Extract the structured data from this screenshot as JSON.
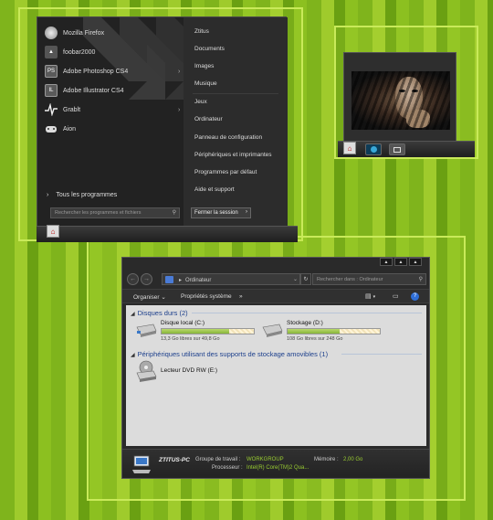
{
  "start_menu": {
    "programs": [
      {
        "label": "Mozilla Firefox",
        "icon": "firefox-icon",
        "submenu": false
      },
      {
        "label": "foobar2000",
        "icon": "foobar-icon",
        "submenu": false
      },
      {
        "label": "Adobe Photoshop CS4",
        "icon": "photoshop-icon",
        "badge": "PS",
        "submenu": true
      },
      {
        "label": "Adobe Illustrator CS4",
        "icon": "illustrator-icon",
        "badge": "IL",
        "submenu": false
      },
      {
        "label": "Grablt",
        "icon": "grabit-icon",
        "submenu": true
      },
      {
        "label": "Aion",
        "icon": "gamepad-icon",
        "submenu": false
      }
    ],
    "all_programs": "Tous les programmes",
    "search_placeholder": "Rechercher les programmes et fichiers",
    "links": [
      "Ztitus",
      "Documents",
      "Images",
      "Musique",
      "Jeux",
      "Ordinateur",
      "Panneau de configuration",
      "Périphériques et imprimantes",
      "Programmes par défaut",
      "Aide et support"
    ],
    "shutdown_label": "Fermer la session"
  },
  "explorer": {
    "address_location": "Ordinateur",
    "search_placeholder": "Rechercher dans : Ordinateur",
    "toolbar": {
      "organize": "Organiser",
      "system_properties": "Propriétés système",
      "more": "»"
    },
    "hard_disks_title": "Disques durs (2)",
    "drives": [
      {
        "name": "Disque local (C:)",
        "free_text": "13,3 Go libres sur 49,8 Go",
        "used_fraction": 0.73
      },
      {
        "name": "Stockage (D:)",
        "free_text": "108 Go libres sur 248 Go",
        "used_fraction": 0.56
      }
    ],
    "removable_title": "Périphériques utilisant des supports de stockage amovibles (1)",
    "dvd_name": "Lecteur DVD RW (E:)",
    "details": {
      "computer_name": "ZTITUS-PC",
      "workgroup_label": "Groupe de travail :",
      "workgroup_value": "WORKGROUP",
      "memory_label": "Mémoire :",
      "memory_value": "2,00 Go",
      "processor_label": "Processeur :",
      "processor_value": "Intel(R) Core(TM)2 Qua..."
    }
  },
  "colors": {
    "accent_green": "#9acd32",
    "link_blue": "#1c3f8c"
  }
}
